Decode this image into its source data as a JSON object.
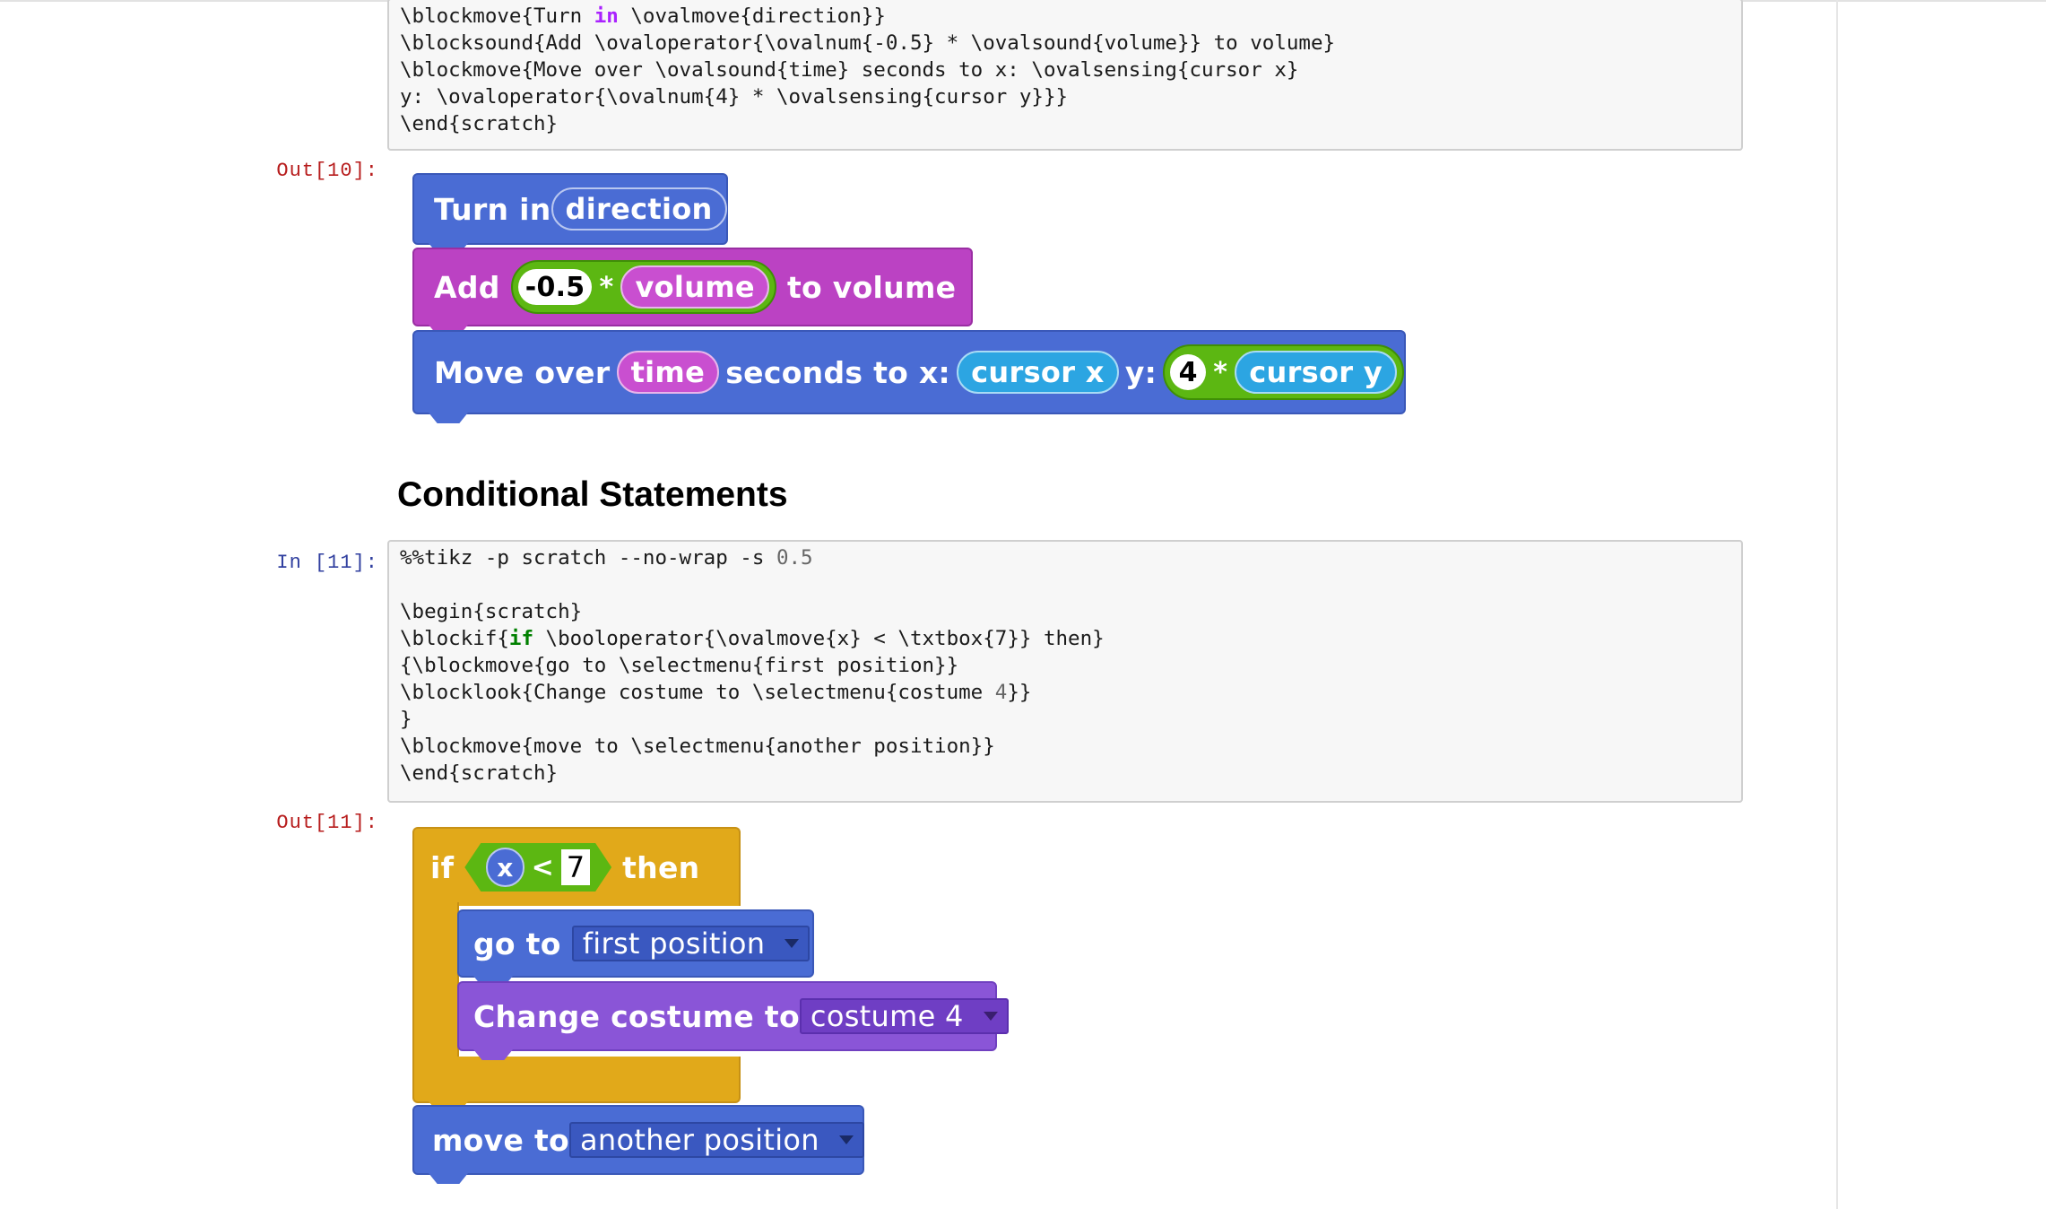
{
  "cell10": {
    "out_prompt": "Out[10]:",
    "code_lines": [
      [
        "\\blockmove{Turn ",
        "in",
        " \\ovalmove{direction}}"
      ],
      "\\blocksound{Add \\ovaloperator{\\ovalnum{-0.5} * \\ovalsound{volume}} to volume}",
      "\\blockmove{Move over \\ovalsound{time} seconds to x: \\ovalsensing{cursor x}",
      "y: \\ovaloperator{\\ovalnum{4} * \\ovalsensing{cursor y}}}",
      "\\end{scratch}"
    ],
    "blocks": {
      "turn_label": "Turn in",
      "turn_oval": "direction",
      "add_label": "Add",
      "add_num": "-0.5",
      "add_op": "*",
      "add_oval": "volume",
      "add_suffix": "to volume",
      "move_label": "Move over",
      "move_time": "time",
      "move_mid": "seconds to x:",
      "move_cursorx": "cursor x",
      "move_y": "y:",
      "move_num": "4",
      "move_op": "*",
      "move_cursory": "cursor y"
    }
  },
  "heading": "Conditional Statements",
  "cell11": {
    "in_prompt": "In [11]:",
    "out_prompt": "Out[11]:",
    "code_line0": "%%tikz -p scratch --no-wrap -s ",
    "code_line0_num": "0.5",
    "code_line1": "\\begin{scratch}",
    "code_line2_a": "\\blockif{",
    "code_line2_kw": "if",
    "code_line2_b": " \\booloperator{\\ovalmove{x} < \\txtbox{7}} then}",
    "code_line3": "{\\blockmove{go to \\selectmenu{first position}}",
    "code_line4_a": "\\blocklook{Change costume to \\selectmenu{costume ",
    "code_line4_num": "4",
    "code_line4_b": "}}",
    "code_line5": "}",
    "code_line6": "\\blockmove{move to \\selectmenu{another position}}",
    "code_line7": "\\end{scratch}",
    "blocks": {
      "if_label": "if",
      "if_var": "x",
      "if_op": "<",
      "if_value": "7",
      "then_label": "then",
      "goto_label": "go to",
      "goto_menu": "first position",
      "costume_label": "Change costume to",
      "costume_menu": "costume 4",
      "moveto_label": "move to",
      "moveto_menu": "another position"
    }
  },
  "colors": {
    "motion": "#4a6cd4",
    "sound": "#bb42c3",
    "looks": "#8a55d7",
    "control": "#e1a91a",
    "operator": "#5cb712",
    "sensing": "#2ca5e2"
  }
}
